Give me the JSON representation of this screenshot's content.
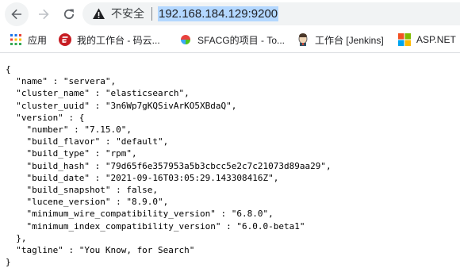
{
  "address_bar": {
    "security_label": "不安全",
    "url": "192.168.184.129:9200"
  },
  "bookmarks": [
    {
      "label": "应用",
      "icon": "apps-grid-icon"
    },
    {
      "label": "我的工作台 - 码云...",
      "icon": "gitee-icon"
    },
    {
      "label": "SFACG的项目 - To...",
      "icon": "teambition-icon"
    },
    {
      "label": "工作台 [Jenkins]",
      "icon": "jenkins-icon"
    },
    {
      "label": "ASP.NET",
      "icon": "microsoft-icon"
    }
  ],
  "json_lines": [
    "{",
    "  \"name\" : \"servera\",",
    "  \"cluster_name\" : \"elasticsearch\",",
    "  \"cluster_uuid\" : \"3n6Wp7gKQSivArKO5XBdaQ\",",
    "  \"version\" : {",
    "    \"number\" : \"7.15.0\",",
    "    \"build_flavor\" : \"default\",",
    "    \"build_type\" : \"rpm\",",
    "    \"build_hash\" : \"79d65f6e357953a5b3cbcc5e2c7c21073d89aa29\",",
    "    \"build_date\" : \"2021-09-16T03:05:29.143308416Z\",",
    "    \"build_snapshot\" : false,",
    "    \"lucene_version\" : \"8.9.0\",",
    "    \"minimum_wire_compatibility_version\" : \"6.8.0\",",
    "    \"minimum_index_compatibility_version\" : \"6.0.0-beta1\"",
    "  },",
    "  \"tagline\" : \"You Know, for Search\"",
    "}"
  ]
}
